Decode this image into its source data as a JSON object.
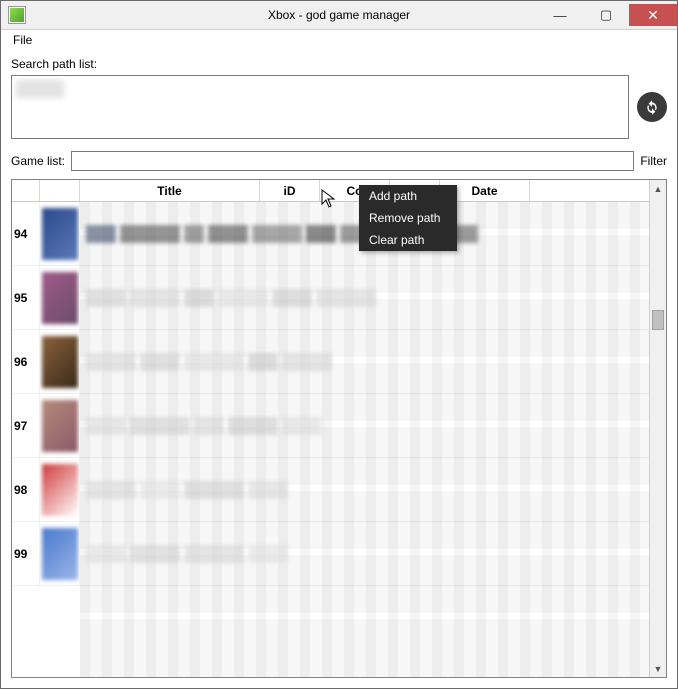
{
  "window": {
    "title": "Xbox - god game manager",
    "minimize_label": "—",
    "maximize_label": "▢",
    "close_label": "✕"
  },
  "menu": {
    "file": "File"
  },
  "search_path": {
    "label": "Search path list:"
  },
  "game_list": {
    "label": "Game list:",
    "filter_value": "",
    "filter_label": "Filter"
  },
  "columns": {
    "num": "",
    "thumb": "",
    "title": "Title",
    "id": "iD",
    "console": "Co",
    "blank": "",
    "date": "Date"
  },
  "rows": [
    {
      "index": "94"
    },
    {
      "index": "95"
    },
    {
      "index": "96"
    },
    {
      "index": "97"
    },
    {
      "index": "98"
    },
    {
      "index": "99"
    }
  ],
  "context_menu": {
    "add": "Add path",
    "remove": "Remove path",
    "clear": "Clear path"
  }
}
